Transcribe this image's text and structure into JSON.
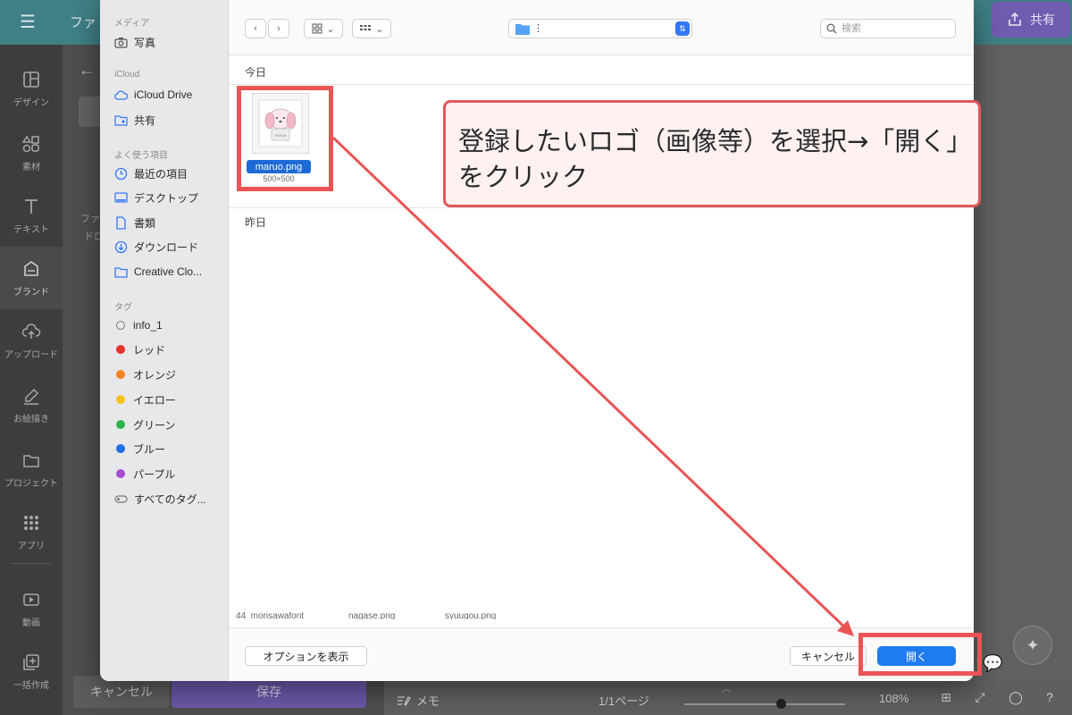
{
  "background_app": {
    "file_title": "ファ",
    "share_label": "共有",
    "rail": [
      {
        "label": "デザイン",
        "icon": "layout-icon"
      },
      {
        "label": "素材",
        "icon": "shapes-icon"
      },
      {
        "label": "テキスト",
        "icon": "text-icon"
      },
      {
        "label": "ブランド",
        "icon": "brand-icon"
      },
      {
        "label": "アップロード",
        "icon": "upload-icon"
      },
      {
        "label": "お絵描き",
        "icon": "draw-icon"
      },
      {
        "label": "プロジェクト",
        "icon": "folder-icon"
      },
      {
        "label": "アプリ",
        "icon": "apps-icon"
      },
      {
        "label": "動画",
        "icon": "video-icon"
      },
      {
        "label": "一括作成",
        "icon": "bulk-create-icon"
      }
    ],
    "panel_text_1": "ファ",
    "panel_text_2": "ドロ",
    "cancel_label": "キャンセル",
    "save_label": "保存",
    "bottom": {
      "memo_label": "メモ",
      "pages": "1/1ページ",
      "zoom": "108%",
      "zoom_fraction": 0.6
    }
  },
  "dialog": {
    "sidebar": {
      "sections": [
        {
          "heading": "メディア",
          "items": [
            {
              "label": "写真",
              "icon": "camera-icon"
            }
          ]
        },
        {
          "heading": "iCloud",
          "items": [
            {
              "label": "iCloud Drive",
              "icon": "cloud-icon"
            },
            {
              "label": "共有",
              "icon": "shared-folder-icon"
            }
          ]
        },
        {
          "heading": "よく使う項目",
          "items": [
            {
              "label": "最近の項目",
              "icon": "clock-icon"
            },
            {
              "label": "デスクトップ",
              "icon": "desktop-icon"
            },
            {
              "label": "書類",
              "icon": "document-icon"
            },
            {
              "label": "ダウンロード",
              "icon": "download-icon"
            },
            {
              "label": "Creative Clo...",
              "icon": "folder-icon"
            }
          ]
        },
        {
          "heading": "タグ",
          "items": [
            {
              "label": "info_1",
              "color": "hollow"
            },
            {
              "label": "レッド",
              "color": "#e5322d"
            },
            {
              "label": "オレンジ",
              "color": "#f5821f"
            },
            {
              "label": "イエロー",
              "color": "#f4c21b"
            },
            {
              "label": "グリーン",
              "color": "#2eb34a"
            },
            {
              "label": "ブルー",
              "color": "#1f6fe5"
            },
            {
              "label": "パープル",
              "color": "#a34ed1"
            },
            {
              "label": "すべてのタグ...",
              "color": "all"
            }
          ]
        }
      ]
    },
    "toolbar": {
      "view_icon": "grid-view-icon",
      "group_icon": "group-icon",
      "search_placeholder": "検索"
    },
    "content": {
      "today_label": "今日",
      "yesterday_label": "昨日",
      "selected_file": {
        "name": "maruo.png",
        "dimensions": "500×500"
      },
      "clipped_files": [
        "44_morisawafont",
        "nagase.png",
        "syuugou.png"
      ]
    },
    "footer": {
      "options_label": "オプションを表示",
      "cancel_label": "キャンセル",
      "open_label": "開く"
    }
  },
  "annotation": {
    "line1": "登録したいロゴ（画像等）を選択→「開く」",
    "line2": "をクリック",
    "color": "#ea5455"
  }
}
